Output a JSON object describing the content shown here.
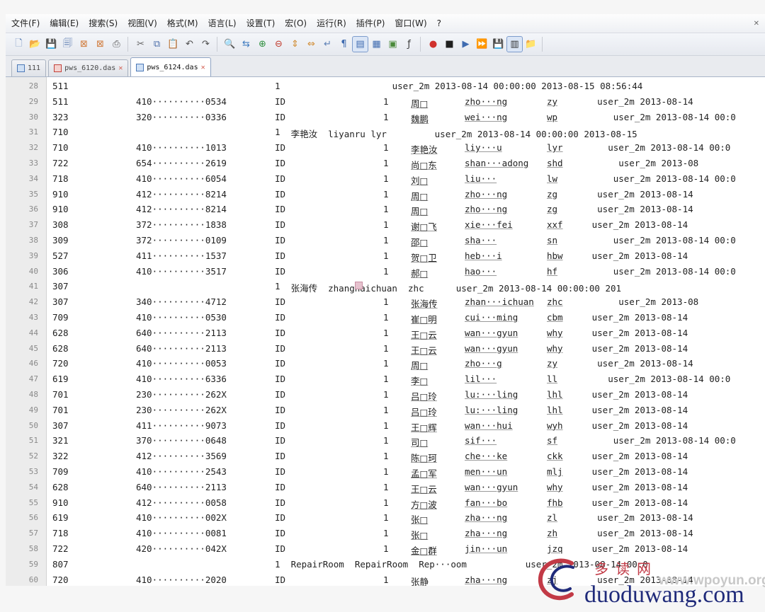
{
  "menu": [
    "文件(F)",
    "编辑(E)",
    "搜索(S)",
    "视图(V)",
    "格式(M)",
    "语言(L)",
    "设置(T)",
    "宏(O)",
    "运行(R)",
    "插件(P)",
    "窗口(W)",
    "?"
  ],
  "menu_close": "✕",
  "toolbar": {
    "groups": [
      [
        {
          "name": "new-file-icon",
          "glyph": "🗋",
          "color": "#5b7fb6"
        },
        {
          "name": "open-file-icon",
          "glyph": "📂",
          "color": "#d8a63b"
        },
        {
          "name": "save-icon",
          "glyph": "💾",
          "color": "#4b6ea9"
        },
        {
          "name": "save-all-icon",
          "glyph": "🗐",
          "color": "#4b6ea9"
        },
        {
          "name": "close-file-icon",
          "glyph": "⊠",
          "color": "#d07a3a"
        },
        {
          "name": "close-all-icon",
          "glyph": "⊠",
          "color": "#d07a3a"
        },
        {
          "name": "print-icon",
          "glyph": "⎙",
          "color": "#555555"
        }
      ],
      [
        {
          "name": "cut-icon",
          "glyph": "✂",
          "color": "#666666"
        },
        {
          "name": "copy-icon",
          "glyph": "⧉",
          "color": "#4b6ea9"
        },
        {
          "name": "paste-icon",
          "glyph": "📋",
          "color": "#b58a3a"
        },
        {
          "name": "undo-icon",
          "glyph": "↶",
          "color": "#4d4d4d"
        },
        {
          "name": "redo-icon",
          "glyph": "↷",
          "color": "#4d4d4d"
        }
      ],
      [
        {
          "name": "find-icon",
          "glyph": "🔍",
          "color": "#3a3a3a"
        },
        {
          "name": "replace-icon",
          "glyph": "⇆",
          "color": "#3f7bc0"
        },
        {
          "name": "zoom-in-icon",
          "glyph": "⊕",
          "color": "#2f8f3f"
        },
        {
          "name": "zoom-out-icon",
          "glyph": "⊖",
          "color": "#c0392b"
        },
        {
          "name": "sync-v-icon",
          "glyph": "⇕",
          "color": "#d08a2f"
        },
        {
          "name": "sync-h-icon",
          "glyph": "⇔",
          "color": "#d08a2f"
        },
        {
          "name": "word-wrap-icon",
          "glyph": "↵",
          "color": "#5c7fb5"
        },
        {
          "name": "show-all-chars-icon",
          "glyph": "¶",
          "color": "#3f6bb0"
        },
        {
          "name": "indent-guide-icon",
          "glyph": "▤",
          "color": "#3f6bb0",
          "selected": true
        },
        {
          "name": "user-lang-icon",
          "glyph": "▦",
          "color": "#3f6bb0"
        },
        {
          "name": "doc-map-icon",
          "glyph": "▣",
          "color": "#4a8a3a"
        },
        {
          "name": "function-list-icon",
          "glyph": "ƒ",
          "color": "#3a3a3a"
        }
      ],
      [
        {
          "name": "record-macro-icon",
          "glyph": "●",
          "color": "#d0312d"
        },
        {
          "name": "stop-macro-icon",
          "glyph": "■",
          "color": "#1f1f1f"
        },
        {
          "name": "play-macro-icon",
          "glyph": "▶",
          "color": "#3f6bb0"
        },
        {
          "name": "play-multiple-icon",
          "glyph": "⏩",
          "color": "#3f6bb0"
        },
        {
          "name": "save-macro-icon",
          "glyph": "💾",
          "color": "#3f6bb0"
        },
        {
          "name": "panel-icon",
          "glyph": "▥",
          "color": "#333333",
          "selected": true
        },
        {
          "name": "folder-icon",
          "glyph": "📁",
          "color": "#d8a63b"
        }
      ]
    ]
  },
  "tabs": [
    {
      "label": "111",
      "icon": "blue",
      "active": false
    },
    {
      "label": "pws_6120.das",
      "icon": "red",
      "active": false
    },
    {
      "label": "pws_6124.das",
      "icon": "blue",
      "active": true
    }
  ],
  "tab_close": "✕",
  "lines": [
    {
      "n": "28",
      "c1": "511",
      "c2": "",
      "c3": "1",
      "tail": "                      user_2m 2013-08-14 00:00:00 2013-08-15 08:56:44"
    },
    {
      "n": "29",
      "c1": "511",
      "c2": "410··········0534",
      "c3": "ID",
      "c4": "1",
      "c5": "周□",
      "c6": "zho···ng",
      "c7": "zy",
      "c8": "      user_2m 2013-08-14"
    },
    {
      "n": "30",
      "c1": "323",
      "c2": "320··········0336",
      "c3": "ID",
      "c4": "1",
      "c5": "魏鹏",
      "c6": "wei···ng",
      "c7": "wp",
      "c8": "         user_2m 2013-08-14 00:0"
    },
    {
      "n": "31",
      "c1": "710",
      "c2": "",
      "c3": "1",
      "tail": "   李艳汝  liyanru lyr         user_2m 2013-08-14 00:00:00 2013-08-15"
    },
    {
      "n": "32",
      "c1": "710",
      "c2": "410··········1013",
      "c3": "ID",
      "c4": "1",
      "c5": "李艳汝",
      "c6": "liy···u",
      "c7": "lyr",
      "c8": "        user_2m 2013-08-14 00:0"
    },
    {
      "n": "33",
      "c1": "722",
      "c2": "654··········2619",
      "c3": "ID",
      "c4": "1",
      "c5": "尚□东",
      "c6": "shan···adong",
      "c7": "shd",
      "c8": "          user_2m 2013-08"
    },
    {
      "n": "34",
      "c1": "718",
      "c2": "410··········6054",
      "c3": "ID",
      "c4": "1",
      "c5": "刘□",
      "c6": "liu···",
      "c7": "lw",
      "c8": "         user_2m 2013-08-14 00:0"
    },
    {
      "n": "35",
      "c1": "910",
      "c2": "412··········8214",
      "c3": "ID",
      "c4": "1",
      "c5": "周□",
      "c6": "zho···ng",
      "c7": "zg",
      "c8": "      user_2m 2013-08-14"
    },
    {
      "n": "36",
      "c1": "910",
      "c2": "412··········8214",
      "c3": "ID",
      "c4": "1",
      "c5": "周□",
      "c6": "zho···ng",
      "c7": "zg",
      "c8": "      user_2m 2013-08-14"
    },
    {
      "n": "37",
      "c1": "308",
      "c2": "372··········1838",
      "c3": "ID",
      "c4": "1",
      "c5": "谢□飞",
      "c6": "xie···fei",
      "c7": "xxf",
      "c8": "     user_2m 2013-08-14"
    },
    {
      "n": "38",
      "c1": "309",
      "c2": "372··········0109",
      "c3": "ID",
      "c4": "1",
      "c5": "邵□",
      "c6": "sha···",
      "c7": "sn",
      "c8": "         user_2m 2013-08-14 00:0"
    },
    {
      "n": "39",
      "c1": "527",
      "c2": "411··········1537",
      "c3": "ID",
      "c4": "1",
      "c5": "贺□卫",
      "c6": "heb···i",
      "c7": "hbw",
      "c8": "     user_2m 2013-08-14"
    },
    {
      "n": "40",
      "c1": "306",
      "c2": "410··········3517",
      "c3": "ID",
      "c4": "1",
      "c5": "郝□",
      "c6": "hao···",
      "c7": "hf",
      "c8": "         user_2m 2013-08-14 00:0"
    },
    {
      "n": "41",
      "c1": "307",
      "c2": "",
      "c3": "1",
      "tail": "   张海传  zhanghaichuan  zhc      user_2m 2013-08-14 00:00:00 201",
      "mark": true
    },
    {
      "n": "42",
      "c1": "307",
      "c2": "340··········4712",
      "c3": "ID",
      "c4": "1",
      "c5": "张海传",
      "c6": "zhan···ichuan",
      "c7": "zhc",
      "c8": "          user_2m 2013-08"
    },
    {
      "n": "43",
      "c1": "709",
      "c2": "410··········0530",
      "c3": "ID",
      "c4": "1",
      "c5": "崔□明",
      "c6": "cui···ming",
      "c7": "cbm",
      "c8": "     user_2m 2013-08-14"
    },
    {
      "n": "44",
      "c1": "628",
      "c2": "640··········2113",
      "c3": "ID",
      "c4": "1",
      "c5": "王□云",
      "c6": "wan···gyun",
      "c7": "why",
      "c8": "     user_2m 2013-08-14"
    },
    {
      "n": "45",
      "c1": "628",
      "c2": "640··········2113",
      "c3": "ID",
      "c4": "1",
      "c5": "王□云",
      "c6": "wan···gyun",
      "c7": "why",
      "c8": "     user_2m 2013-08-14"
    },
    {
      "n": "46",
      "c1": "720",
      "c2": "410··········0053",
      "c3": "ID",
      "c4": "1",
      "c5": "周□",
      "c6": "zho···g",
      "c7": "zy",
      "c8": "      user_2m 2013-08-14"
    },
    {
      "n": "47",
      "c1": "619",
      "c2": "410··········6336",
      "c3": "ID",
      "c4": "1",
      "c5": "李□",
      "c6": "lil···",
      "c7": "ll",
      "c8": "        user_2m 2013-08-14 00:0"
    },
    {
      "n": "48",
      "c1": "701",
      "c2": "230··········262X",
      "c3": "ID",
      "c4": "1",
      "c5": "吕□玲",
      "c6": "lu:···ling",
      "c7": "lhl",
      "c8": "     user_2m 2013-08-14"
    },
    {
      "n": "49",
      "c1": "701",
      "c2": "230··········262X",
      "c3": "ID",
      "c4": "1",
      "c5": "吕□玲",
      "c6": "lu:···ling",
      "c7": "lhl",
      "c8": "     user_2m 2013-08-14"
    },
    {
      "n": "50",
      "c1": "307",
      "c2": "411··········9073",
      "c3": "ID",
      "c4": "1",
      "c5": "王□辉",
      "c6": "wan···hui",
      "c7": "wyh",
      "c8": "     user_2m 2013-08-14"
    },
    {
      "n": "51",
      "c1": "321",
      "c2": "370··········0648",
      "c3": "ID",
      "c4": "1",
      "c5": "司□",
      "c6": "sif···",
      "c7": "sf",
      "c8": "         user_2m 2013-08-14 00:0"
    },
    {
      "n": "52",
      "c1": "322",
      "c2": "412··········3569",
      "c3": "ID",
      "c4": "1",
      "c5": "陈□珂",
      "c6": "che···ke",
      "c7": "ckk",
      "c8": "     user_2m 2013-08-14"
    },
    {
      "n": "53",
      "c1": "709",
      "c2": "410··········2543",
      "c3": "ID",
      "c4": "1",
      "c5": "孟□军",
      "c6": "men···un",
      "c7": "mlj",
      "c8": "     user_2m 2013-08-14"
    },
    {
      "n": "54",
      "c1": "628",
      "c2": "640··········2113",
      "c3": "ID",
      "c4": "1",
      "c5": "王□云",
      "c6": "wan···gyun",
      "c7": "why",
      "c8": "     user_2m 2013-08-14"
    },
    {
      "n": "55",
      "c1": "910",
      "c2": "412··········0058",
      "c3": "ID",
      "c4": "1",
      "c5": "方□波",
      "c6": "fan···bo",
      "c7": "fhb",
      "c8": "     user_2m 2013-08-14"
    },
    {
      "n": "56",
      "c1": "619",
      "c2": "410··········002X",
      "c3": "ID",
      "c4": "1",
      "c5": "张□",
      "c6": "zha···ng",
      "c7": "zl",
      "c8": "      user_2m 2013-08-14"
    },
    {
      "n": "57",
      "c1": "718",
      "c2": "410··········0081",
      "c3": "ID",
      "c4": "1",
      "c5": "张□",
      "c6": "zha···ng",
      "c7": "zh",
      "c8": "      user_2m 2013-08-14"
    },
    {
      "n": "58",
      "c1": "722",
      "c2": "420··········042X",
      "c3": "ID",
      "c4": "1",
      "c5": "金□群",
      "c6": "jin···un",
      "c7": "jzq",
      "c8": "     user_2m 2013-08-14"
    },
    {
      "n": "59",
      "c1": "807",
      "c2": "",
      "c3": "1",
      "tail": "   RepairRoom  RepairRoom  Rep···oom           user_2m 2013-08-14 00:0"
    },
    {
      "n": "60",
      "c1": "720",
      "c2": "410··········2020",
      "c3": "ID",
      "c4": "1",
      "c5": "张静",
      "c6": "zha···ng",
      "c7": "zj",
      "c8": "      user_2m 2013-08-14"
    }
  ],
  "watermark": {
    "cn": "多读网",
    "url_a": "www.wpoyun.org",
    "url_b": "duoduwang.com",
    "accent": "#c23a46",
    "blue": "#1f2a7a"
  }
}
